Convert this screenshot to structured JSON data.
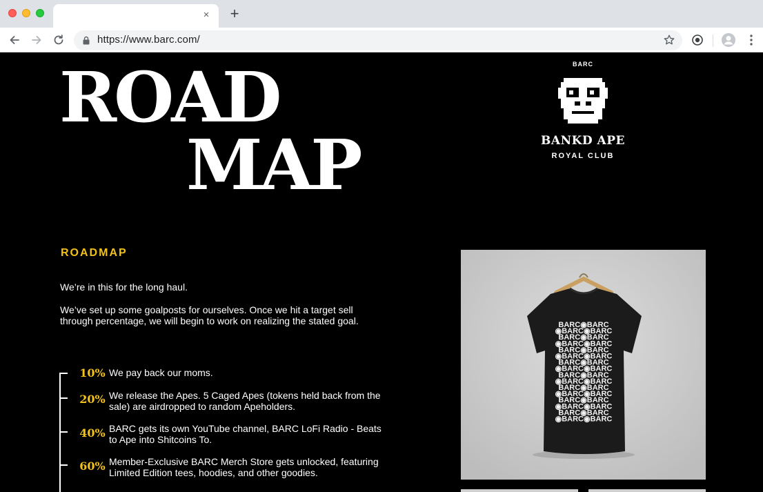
{
  "browser": {
    "url": "https://www.barc.com/",
    "close_glyph": "×",
    "new_tab_glyph": "+",
    "icons": [
      "back-icon",
      "forward-icon",
      "reload-icon",
      "lock-icon",
      "star-icon",
      "extension-icon",
      "profile-icon",
      "menu-icon"
    ]
  },
  "hero": {
    "line1": "ROAD",
    "line2": "MAP"
  },
  "brand": {
    "small": "BARC",
    "name": "BANKD APE",
    "sub": "ROYAL CLUB"
  },
  "roadmap": {
    "title": "ROADMAP",
    "intro": "We’re in this for the long haul.",
    "intro2": "We’ve set up some goalposts for ourselves. Once we hit a target sell through percentage, we will begin to work on realizing the stated goal.",
    "milestones": [
      {
        "pct": "10%",
        "text": "We pay back our moms."
      },
      {
        "pct": "20%",
        "text": "We release the Apes. 5 Caged Apes (tokens held back from the sale) are airdropped to random Apeholders."
      },
      {
        "pct": "40%",
        "text": "BARC gets its own YouTube channel, BARC LoFi Radio - Beats to Ape into Shitcoins To."
      },
      {
        "pct": "60%",
        "text": "Member-Exclusive BARC Merch Store gets unlocked, featuring Limited Edition tees, hoodies, and other goodies."
      }
    ]
  },
  "shirt": {
    "print_word": "BARC",
    "rows": 16
  },
  "colors": {
    "accent": "#f2c21b",
    "background": "#000000",
    "text": "#ffffff"
  }
}
